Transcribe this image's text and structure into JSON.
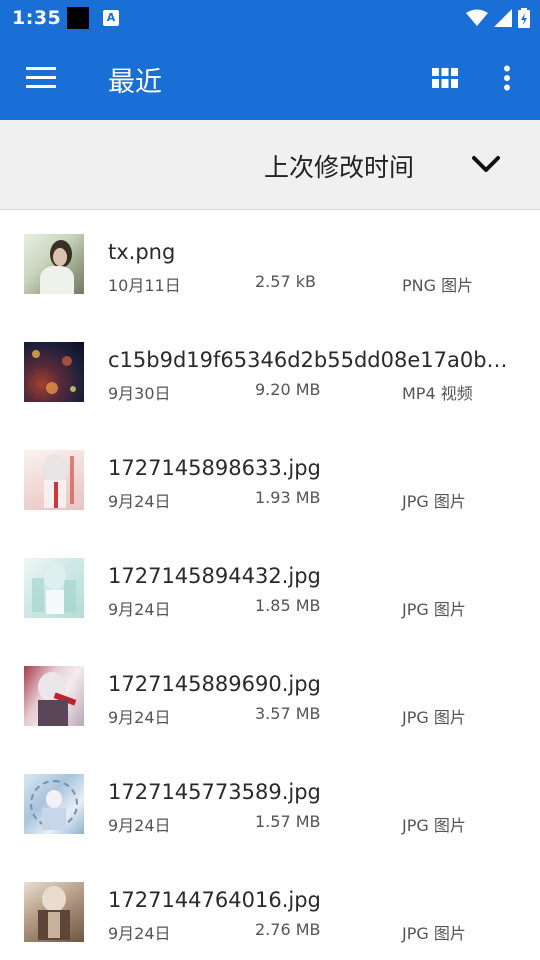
{
  "status_bar": {
    "time": "1:35",
    "notif_letter": "A"
  },
  "app_bar": {
    "title": "最近",
    "menu_icon": "menu-icon",
    "view_icon": "grid-view-icon",
    "more_icon": "more-vert-icon"
  },
  "sort": {
    "label": "上次修改时间",
    "icon": "chevron-down-icon"
  },
  "colors": {
    "primary": "#1a6fd6",
    "sort_bg": "#f0f0f0"
  },
  "files": [
    {
      "name": "tx.png",
      "date": "10月11日",
      "size": "2.57 kB",
      "type": "PNG 图片"
    },
    {
      "name": "c15b9d19f65346d2b55dd08e17a0b3…",
      "date": "9月30日",
      "size": "9.20 MB",
      "type": "MP4 视频"
    },
    {
      "name": "1727145898633.jpg",
      "date": "9月24日",
      "size": "1.93 MB",
      "type": "JPG 图片"
    },
    {
      "name": "1727145894432.jpg",
      "date": "9月24日",
      "size": "1.85 MB",
      "type": "JPG 图片"
    },
    {
      "name": "1727145889690.jpg",
      "date": "9月24日",
      "size": "3.57 MB",
      "type": "JPG 图片"
    },
    {
      "name": "1727145773589.jpg",
      "date": "9月24日",
      "size": "1.57 MB",
      "type": "JPG 图片"
    },
    {
      "name": "1727144764016.jpg",
      "date": "9月24日",
      "size": "2.76 MB",
      "type": "JPG 图片"
    }
  ]
}
